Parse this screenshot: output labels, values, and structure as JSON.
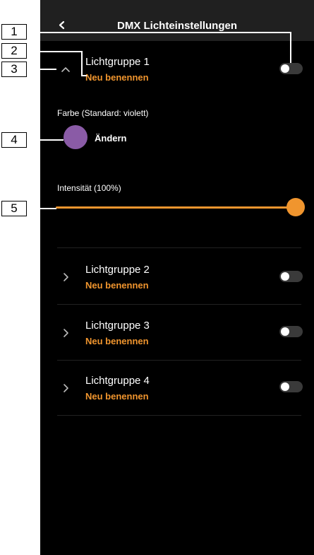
{
  "nav": {
    "title": "DMX Lichteinstellungen",
    "back_icon": "chevron-left-icon"
  },
  "expanded_group": {
    "title": "Lichtgruppe 1",
    "rename": "Neu benennen",
    "toggle_on": false,
    "color_label": "Farbe (Standard: violett)",
    "color_value": "#8a5ba6",
    "color_action": "Ändern",
    "intensity_label": "Intensität (100%)",
    "intensity_value": 1.0
  },
  "groups": [
    {
      "title": "Lichtgruppe 2",
      "rename": "Neu benennen",
      "toggle_on": false
    },
    {
      "title": "Lichtgruppe 3",
      "rename": "Neu benennen",
      "toggle_on": false
    },
    {
      "title": "Lichtgruppe 4",
      "rename": "Neu benennen",
      "toggle_on": false
    }
  ],
  "callouts": [
    "1",
    "2",
    "3",
    "4",
    "5"
  ],
  "colors": {
    "accent": "#f0952e",
    "background": "#000000",
    "navbar": "#202020"
  }
}
